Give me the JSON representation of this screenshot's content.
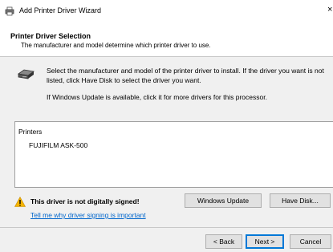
{
  "window": {
    "title": "Add Printer Driver Wizard",
    "close_glyph": "×"
  },
  "header": {
    "title": "Printer Driver Selection",
    "subtitle": "The manufacturer and model determine which printer driver to use."
  },
  "info": {
    "message": "Select the manufacturer and model of the printer driver to install. If the driver you want is not listed, click Have Disk to select the driver you want.",
    "update_message": "If Windows Update is available, click it for more drivers for this processor."
  },
  "printers": {
    "header": "Printers",
    "items": [
      "FUJIFILM ASK-500"
    ]
  },
  "warning": {
    "text": "This driver is not digitally signed!",
    "link": "Tell me why driver signing is important"
  },
  "buttons": {
    "windows_update": "Windows Update",
    "have_disk": "Have Disk...",
    "back": "< Back",
    "next": "Next >",
    "cancel": "Cancel"
  },
  "icons": {
    "title": "printer-icon",
    "info": "printer-icon",
    "warning": "warning-icon"
  },
  "colors": {
    "link": "#0066cc",
    "warning": "#f5b400",
    "focus": "#0078d7"
  }
}
